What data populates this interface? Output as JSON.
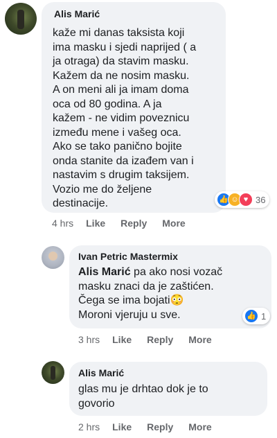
{
  "comments": [
    {
      "author": "Alis Marić",
      "text": "kaže mi danas taksista koji\nima masku i sjedi naprijed ( a\nja otraga) da stavim masku.\nKažem da ne nosim masku.\nA on meni ali ja imam doma\noca od 80 godina. A ja\nkažem - ne vidim poveznicu\nizmeđu mene i vašeg oca.\nAko se tako panično bojite\nonda stanite da izađem van i\nnastavim s drugim taksijem.\nVozio me do željene\ndestinacije.",
      "reactions": {
        "icons": [
          "like",
          "care",
          "love"
        ],
        "count": "36"
      },
      "time": "4 hrs",
      "like_label": "Like",
      "reply_label": "Reply",
      "more_label": "More"
    },
    {
      "author": "Ivan Petric Mastermix",
      "mention": "Alis Marić",
      "text": " pa ako nosi vozač\nmasku znaci da je zaštićen.\nČega se ima bojati",
      "emoji": "😳",
      "text_after": "\nMoroni vjeruju u sve.",
      "reactions": {
        "icons": [
          "like"
        ],
        "count": "1"
      },
      "time": "3 hrs",
      "like_label": "Like",
      "reply_label": "Reply",
      "more_label": "More"
    },
    {
      "author": "Alis Marić",
      "text": "glas mu je drhtao dok je to\ngovorio",
      "time": "2 hrs",
      "like_label": "Like",
      "reply_label": "Reply",
      "more_label": "More"
    }
  ],
  "colors": {
    "bubble": "#f0f2f5",
    "like": "#1877f2",
    "love": "#f33e58",
    "care": "#f7b125",
    "meta": "#65676b"
  }
}
